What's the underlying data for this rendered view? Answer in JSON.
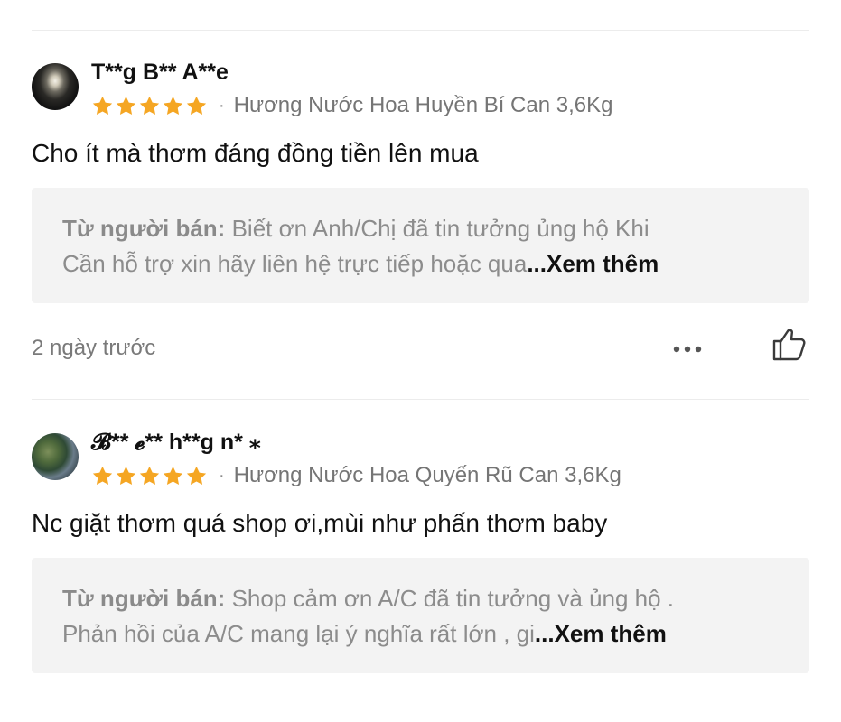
{
  "reviews": [
    {
      "user_name": "T**g B** A**e",
      "rating": 5,
      "variation": "Hương Nước Hoa Huyền Bí Can 3,6Kg",
      "comment": "Cho ít mà thơm đáng đồng tiền lên mua",
      "seller_label": "Từ người bán:",
      "seller_line1": "Biết ơn Anh/Chị đã tin tưởng ủng hộ Khi",
      "seller_line2": "Cần hỗ trợ xin hãy liên hệ trực tiếp hoặc qua",
      "see_more": "...Xem thêm",
      "timestamp": "2 ngày trước"
    },
    {
      "user_name": "𝓑** 𝓮** h**g n* ⁎",
      "rating": 5,
      "variation": "Hương Nước Hoa Quyến Rũ Can 3,6Kg",
      "comment": "Nc giặt thơm quá shop ơi,mùi như phấn thơm baby",
      "seller_label": "Từ người bán:",
      "seller_line1": "Shop cảm ơn A/C đã tin tưởng và ủng hộ .",
      "seller_line2": "Phản hồi của A/C mang lại ý nghĩa rất lớn , gi",
      "see_more": "...Xem thêm"
    }
  ],
  "separator": "·",
  "colors": {
    "star": "#f5a623",
    "seller_box_bg": "#f3f3f3"
  },
  "icons": {
    "more": "more-horizontal-icon",
    "like": "thumbs-up-icon"
  }
}
